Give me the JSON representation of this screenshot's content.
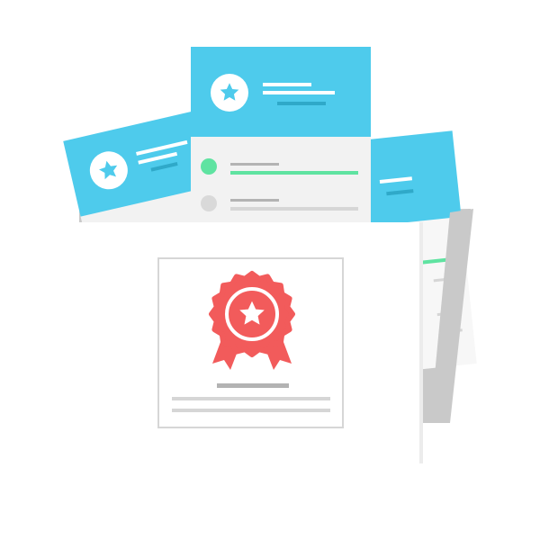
{
  "illustration": {
    "colors": {
      "card_header": "#4ecbec",
      "card_body": "#f2f2f2",
      "card_body_light": "#f7f7f7",
      "folder_back": "#c9c9c9",
      "folder_front": "#ffffff",
      "badge": "#f25b5b",
      "accent_green": "#5fe3a1",
      "dot_grey": "#d9d9d9",
      "line_grey": "#d6d6d6",
      "line_dark": "#b3b3b3",
      "white": "#ffffff",
      "header_line_dark": "#2fa9c9"
    },
    "icons": {
      "card_icon": "star-icon",
      "badge_icon": "award-ribbon-icon",
      "list_marker_active": "green-dot-icon",
      "list_marker_inactive": "grey-dot-icon"
    }
  }
}
